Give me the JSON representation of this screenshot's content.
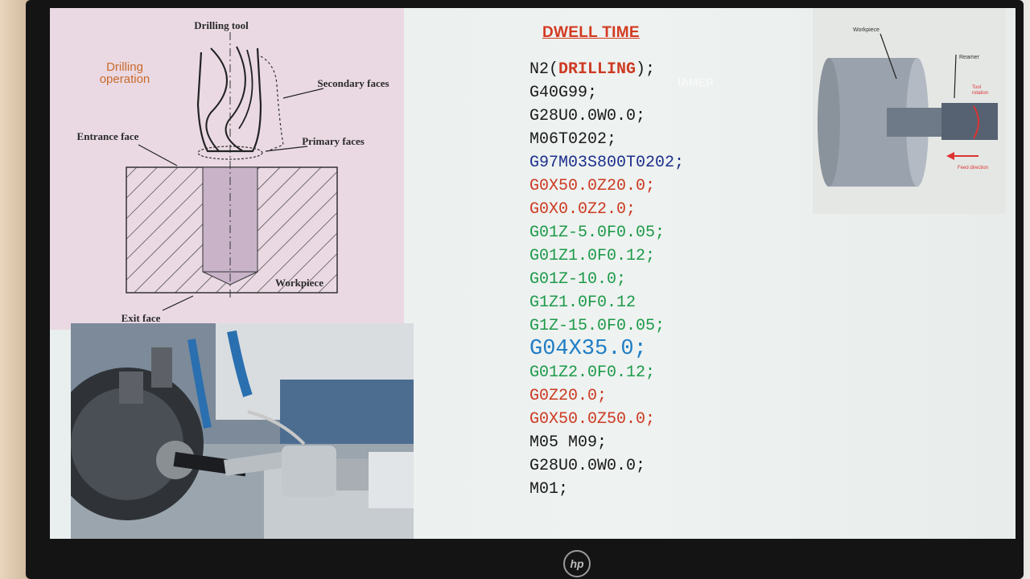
{
  "slide": {
    "title": "DWELL TIME",
    "watermark": "IAMER"
  },
  "diagram": {
    "labels": {
      "drilling_tool": "Drilling tool",
      "drilling_operation": "Drilling operation",
      "secondary_faces": "Secondary faces",
      "entrance_face": "Entrance face",
      "primary_faces": "Primary faces",
      "workpiece": "Workpiece",
      "exit_face": "Exit face"
    }
  },
  "lathe_diagram": {
    "labels": {
      "workpiece": "Workpiece",
      "reamer": "Reamer",
      "tool_rotation": "Tool rotation",
      "feed_direction": "Feed direction"
    }
  },
  "code": {
    "lines": [
      {
        "pre": "N2(",
        "hl": "DRILLING",
        "post": ");",
        "color": "#1a1a1a"
      },
      {
        "text": "G40G99;",
        "color": "#1a1a1a"
      },
      {
        "text": "G28U0.0W0.0;",
        "color": "#1a1a1a"
      },
      {
        "text": "M06T0202;",
        "color": "#1a1a1a"
      },
      {
        "text": "G97M03S800T0202;",
        "color": "#1c2f8c"
      },
      {
        "text": "G0X50.0Z20.0;",
        "color": "#cc3a22"
      },
      {
        "text": "G0X0.0Z2.0;",
        "color": "#cc3a22"
      },
      {
        "text": "G01Z-5.0F0.05;",
        "color": "#1e9a4a"
      },
      {
        "text": "G01Z1.0F0.12;",
        "color": "#1e9a4a"
      },
      {
        "text": "G01Z-10.0;",
        "color": "#1e9a4a"
      },
      {
        "text": "G1Z1.0F0.12",
        "color": "#1e9a4a"
      },
      {
        "text": "G1Z-15.0F0.05;",
        "color": "#1e9a4a"
      },
      {
        "text": "G04X35.0;",
        "color": "#1f7dc4",
        "big": true
      },
      {
        "text": "G01Z2.0F0.12;",
        "color": "#1e9a4a"
      },
      {
        "text": "G0Z20.0;",
        "color": "#cc3a22"
      },
      {
        "text": "G0X50.0Z50.0;",
        "color": "#cc3a22"
      },
      {
        "text": "M05 M09;",
        "color": "#1a1a1a"
      },
      {
        "text": "G28U0.0W0.0;",
        "color": "#1a1a1a"
      },
      {
        "text": "M01;",
        "color": "#1a1a1a"
      }
    ],
    "highlight_color": "#cc3a22"
  },
  "monitor": {
    "brand": "hp"
  }
}
